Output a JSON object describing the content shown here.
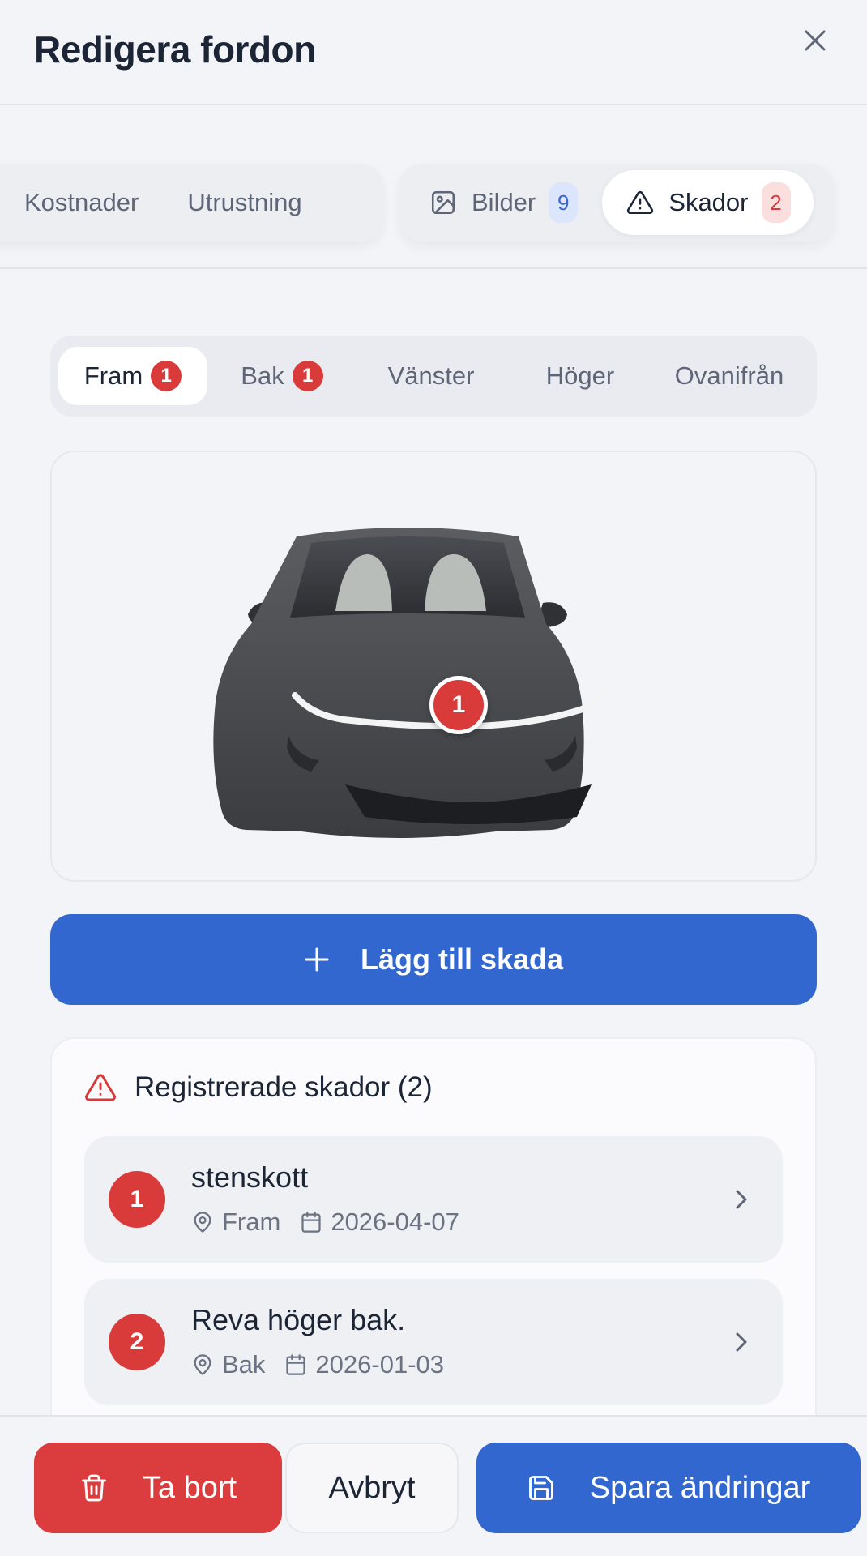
{
  "header": {
    "title": "Redigera fordon",
    "close_icon": "close-icon"
  },
  "tabs": {
    "left": [
      {
        "label": "Kostnader"
      },
      {
        "label": "Utrustning"
      }
    ],
    "right": [
      {
        "label": "Bilder",
        "count": "9",
        "icon": "image-icon"
      },
      {
        "label": "Skador",
        "count": "2",
        "icon": "warning-icon",
        "active": true
      }
    ]
  },
  "views": [
    {
      "label": "Fram",
      "badge": "1",
      "active": true
    },
    {
      "label": "Bak",
      "badge": "1"
    },
    {
      "label": "Vänster"
    },
    {
      "label": "Höger"
    },
    {
      "label": "Ovanifrån"
    }
  ],
  "car": {
    "marker": "1"
  },
  "add_button": {
    "label": "Lägg till skada"
  },
  "damages": {
    "title": "Registrerade skador (2)",
    "items": [
      {
        "num": "1",
        "title": "stenskott",
        "location": "Fram",
        "date": "2026-04-07"
      },
      {
        "num": "2",
        "title": "Reva höger bak.",
        "location": "Bak",
        "date": "2026-01-03"
      }
    ]
  },
  "footer": {
    "delete_label": "Ta bort",
    "cancel_label": "Avbryt",
    "save_label": "Spara ändringar"
  },
  "colors": {
    "accent": "#3267d0",
    "danger": "#d93a3a"
  }
}
